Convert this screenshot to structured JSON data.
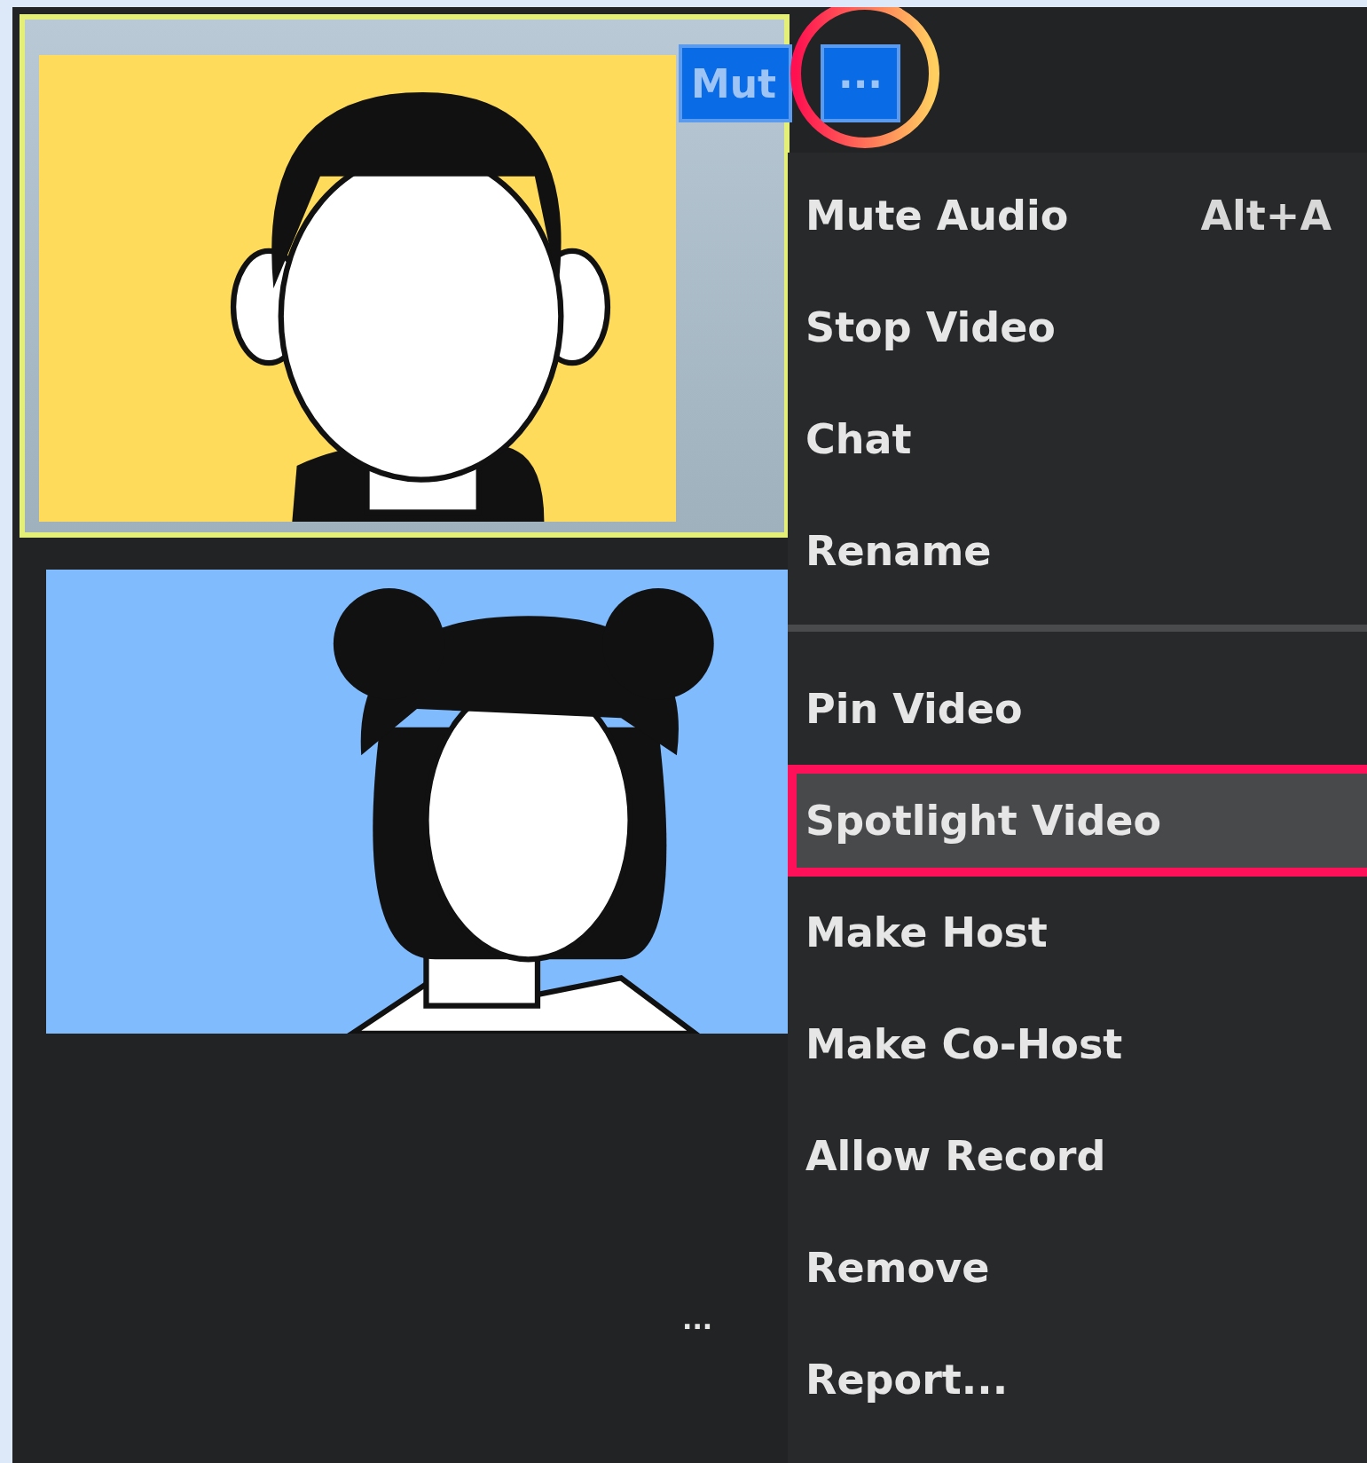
{
  "tiles": [
    {
      "kind": "picture",
      "buttons": [
        {
          "kind": "mute",
          "label": "Mut"
        },
        {
          "kind": "more",
          "label": "···",
          "circled": true
        }
      ]
    },
    {
      "kind": "picture",
      "more_label": "···"
    }
  ],
  "context_menu": {
    "items": [
      {
        "kind": "item",
        "label": "Mute Audio",
        "shortcut": "Alt+A",
        "selected": false
      },
      {
        "kind": "item",
        "label": "Stop Video",
        "selected": false
      },
      {
        "kind": "item",
        "label": "Chat",
        "selected": false
      },
      {
        "kind": "item",
        "label": "Rename",
        "selected": false
      },
      {
        "kind": "separator"
      },
      {
        "kind": "item",
        "label": "Pin Video",
        "selected": false
      },
      {
        "kind": "item",
        "label": "Spotlight Video",
        "selected": true
      },
      {
        "kind": "item",
        "label": "Make Host",
        "selected": false
      },
      {
        "kind": "item",
        "label": "Make Co-Host",
        "selected": false
      },
      {
        "kind": "item",
        "label": "Allow Record",
        "selected": false
      },
      {
        "kind": "item",
        "label": "Remove",
        "selected": false
      },
      {
        "kind": "item",
        "label": "Report...",
        "selected": false
      }
    ]
  }
}
